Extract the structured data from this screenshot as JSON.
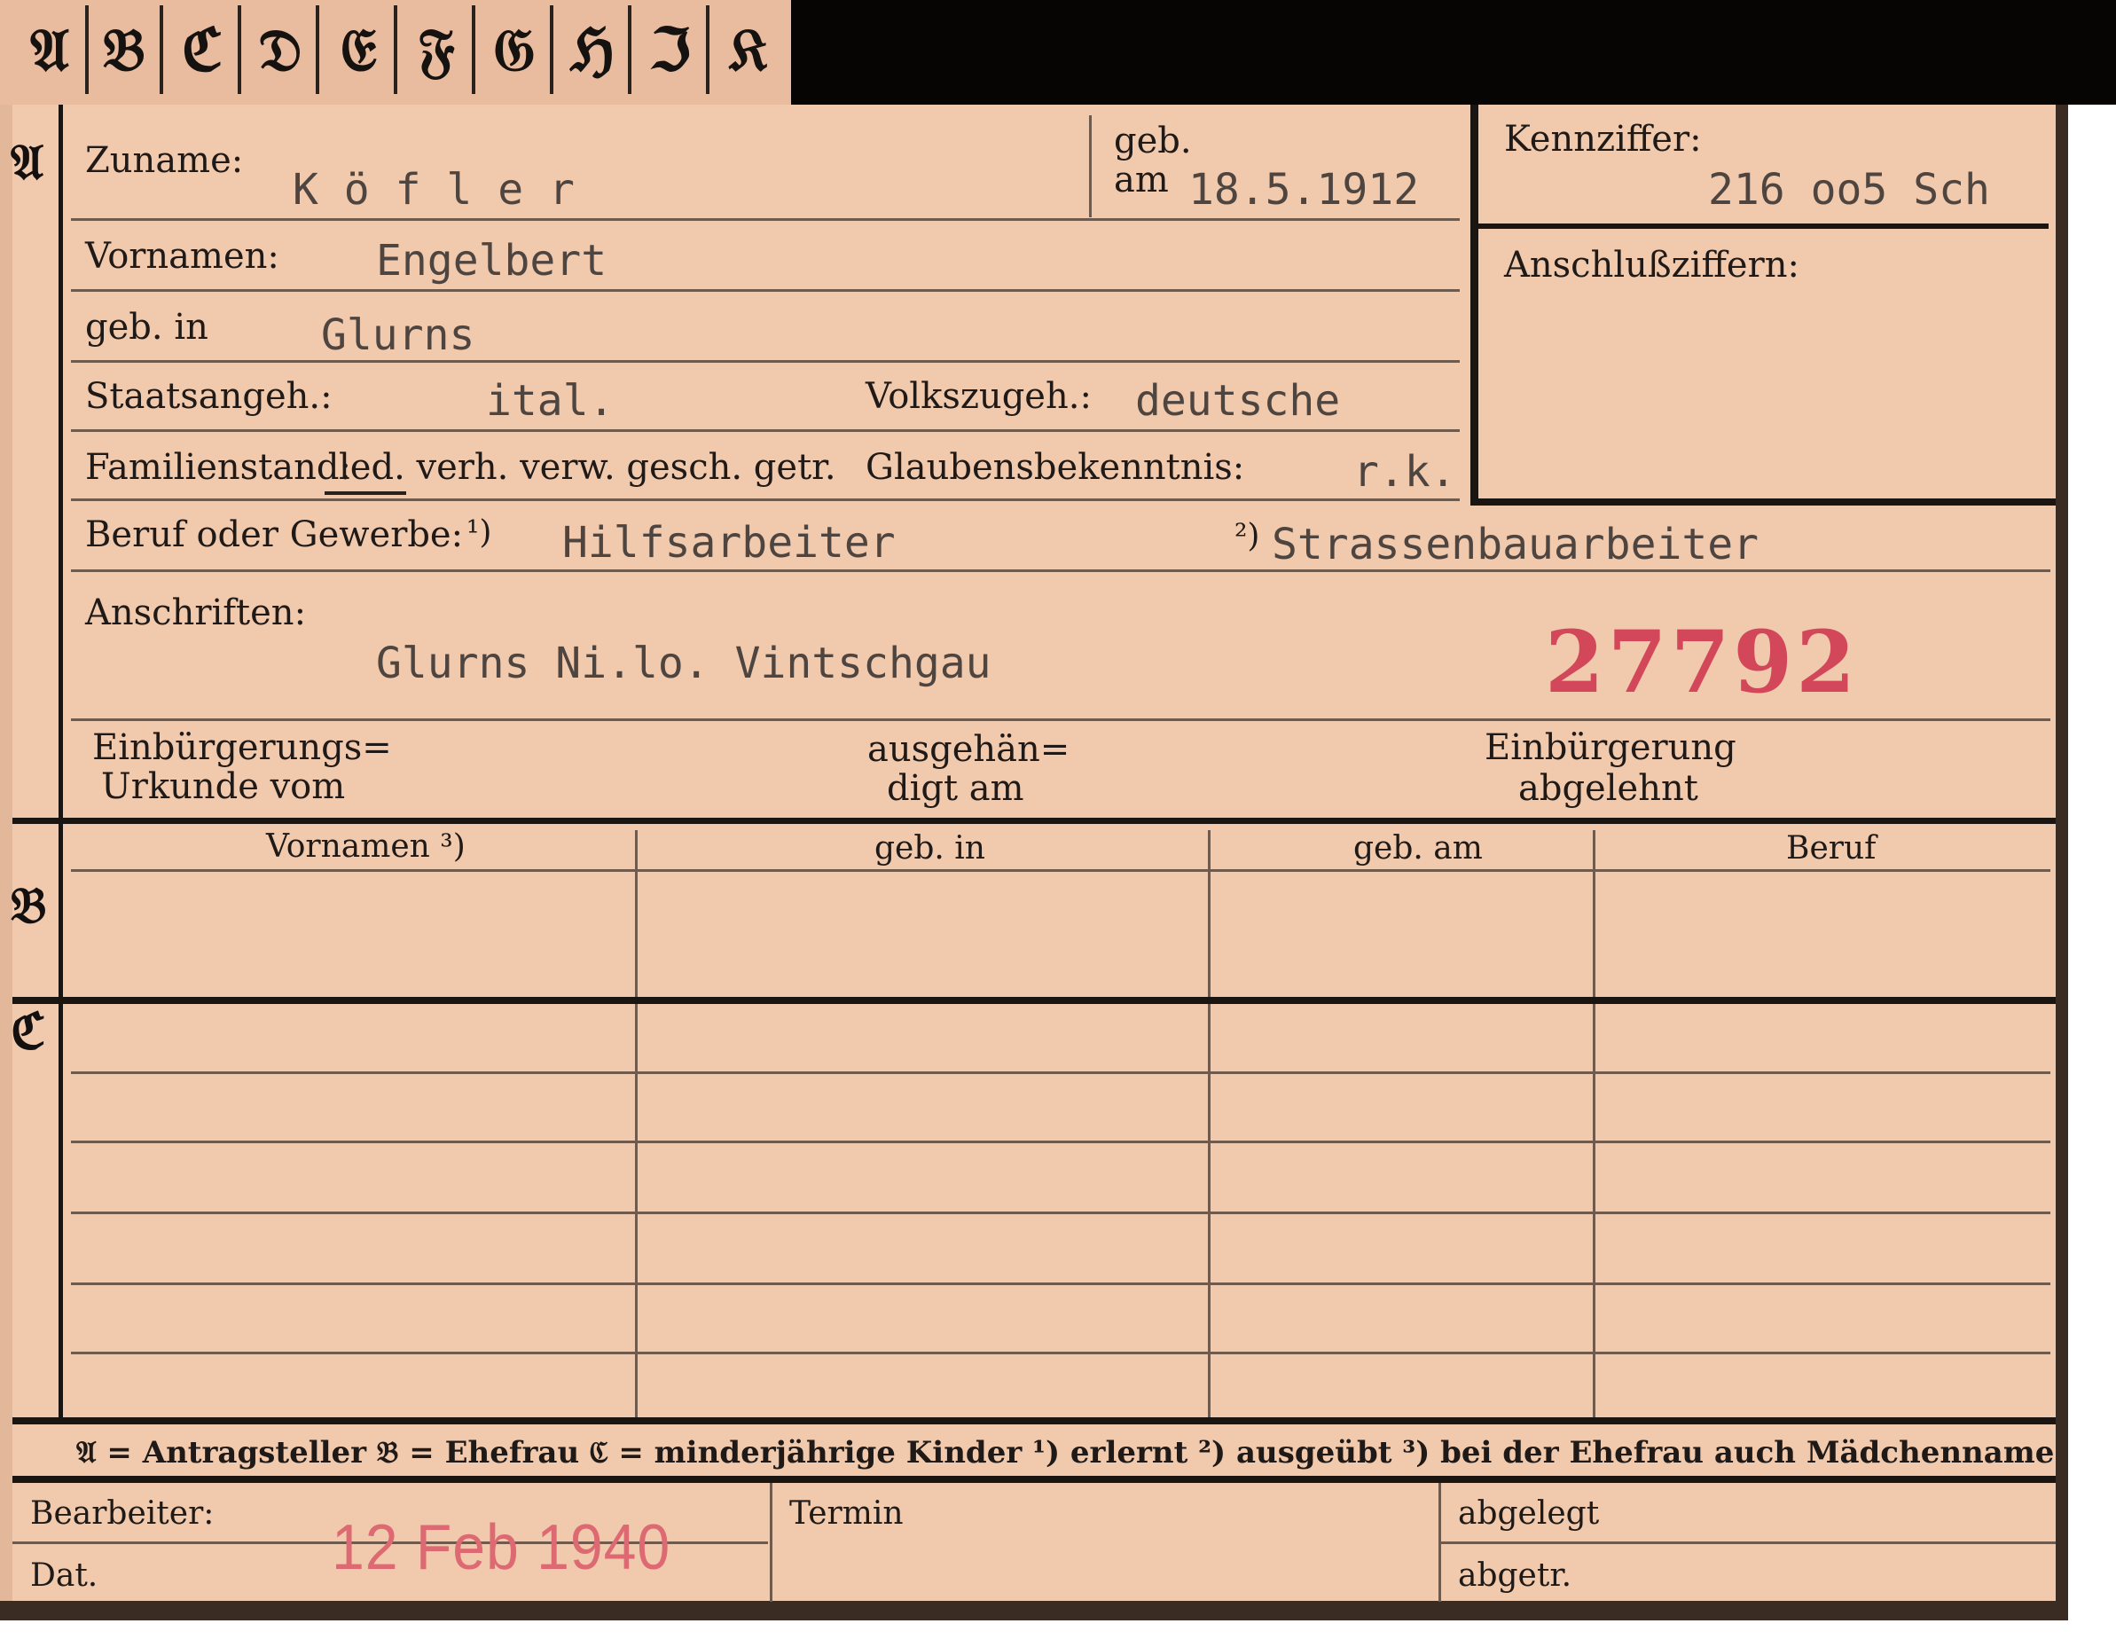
{
  "tabs": [
    "𝔄",
    "𝔅",
    "ℭ",
    "𝔇",
    "𝔈",
    "𝔉",
    "𝔊",
    "ℌ",
    "ℑ",
    "𝔎"
  ],
  "sections": {
    "a": "𝔄",
    "b": "𝔅",
    "c": "ℭ"
  },
  "personal": {
    "zuname_label": "Zuname:",
    "zuname_value": "K ö f l e r",
    "geb_label": "geb.",
    "am_label": "am",
    "geb_am_value": "18.5.1912",
    "vornamen_label": "Vornamen:",
    "vornamen_value": "Engelbert",
    "geb_in_label": "geb. in",
    "geb_in_value": "Glurns",
    "staatsangeh_label": "Staatsangeh.:",
    "staatsangeh_value": "ital.",
    "volkszugeh_label": "Volkszugeh.:",
    "volkszugeh_value": "deutsche",
    "familienstand_label": "Familienstand:",
    "familienstand_options": "led. verh. verw. gesch. getr.",
    "glaubens_label": "Glaubensbekenntnis:",
    "glaubens_value": "r.k.",
    "beruf_label": "Beruf oder Gewerbe:",
    "beruf_mark1": "¹)",
    "beruf_value1": "Hilfsarbeiter",
    "beruf_mark2": "²)",
    "beruf_value2": "Strassenbauarbeiter",
    "anschriften_label": "Anschriften:",
    "anschriften_value": "Glurns Ni.lo. Vintschgau",
    "stamp_number": "27792",
    "einb_urkunde_label1": "Einbürgerungs=",
    "einb_urkunde_label2": "Urkunde vom",
    "ausgehaendigt_label1": "ausgehän=",
    "ausgehaendigt_label2": "digt am",
    "einb_abgelehnt_label1": "Einbürgerung",
    "einb_abgelehnt_label2": "abgelehnt"
  },
  "kennziffer": {
    "label": "Kennziffer:",
    "value": "216 oo5 Sch",
    "anschluss_label": "Anschlußziffern:"
  },
  "table": {
    "headers": [
      "Vornamen ³)",
      "geb. in",
      "geb. am",
      "Beruf"
    ]
  },
  "legend": {
    "text": "𝔄 = Antragsteller   𝔅 = Ehefrau   ℭ = minderjährige Kinder   ¹) erlernt   ²) ausgeübt   ³) bei der Ehefrau auch Mädchenname"
  },
  "footer": {
    "bearbeiter_label": "Bearbeiter:",
    "dat_label": "Dat.",
    "date_stamp": "12 Feb 1940",
    "termin_label": "Termin",
    "abgelegt_label": "abgelegt",
    "abgetr_label": "abgetr."
  },
  "colors": {
    "card": "#f1c9ac",
    "tab_strip": "#e9bca0",
    "ink": "#1f1a17",
    "typewriter": "#4e4540",
    "stamp_red": "#d2485a"
  }
}
